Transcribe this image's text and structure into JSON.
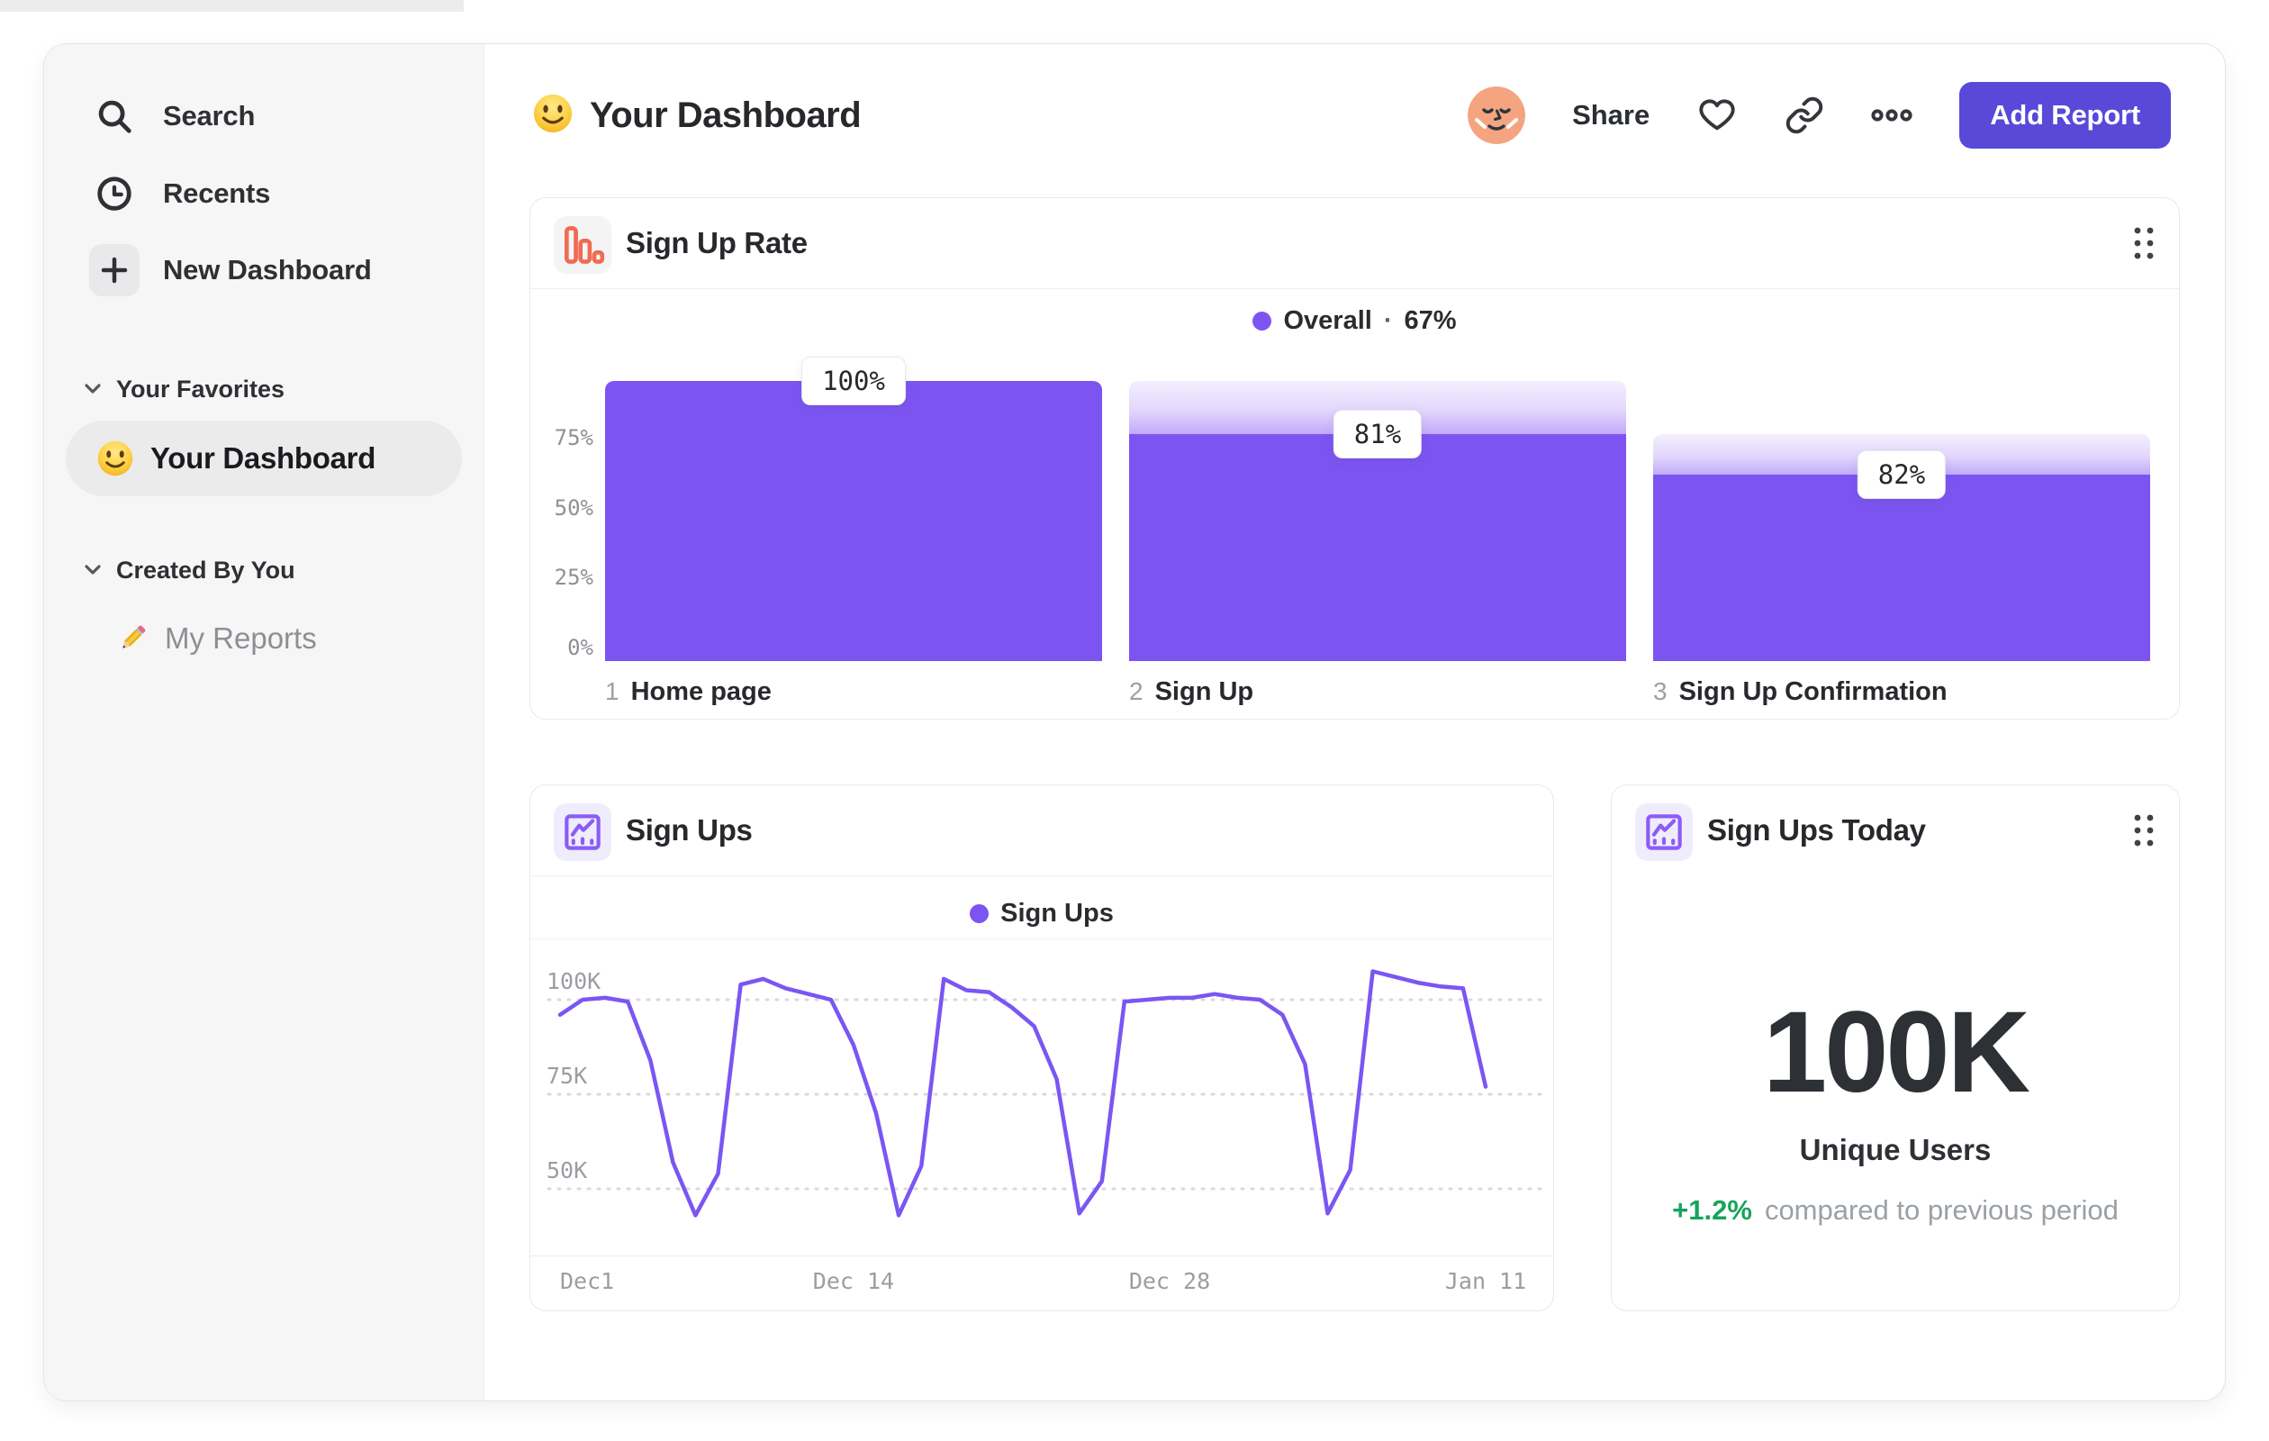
{
  "header": {
    "title": "Your Dashboard",
    "share_label": "Share",
    "add_report_label": "Add Report"
  },
  "sidebar": {
    "items": [
      {
        "label": "Search",
        "icon": "search-icon"
      },
      {
        "label": "Recents",
        "icon": "clock-icon"
      },
      {
        "label": "New Dashboard",
        "icon": "plus-icon"
      }
    ],
    "sections": [
      {
        "title": "Your Favorites",
        "items": [
          {
            "label": "Your Dashboard",
            "icon": "smiley-emoji",
            "selected": true
          }
        ]
      },
      {
        "title": "Created By You",
        "items": [
          {
            "label": "My Reports",
            "icon": "pencil-emoji",
            "selected": false
          }
        ]
      }
    ]
  },
  "colors": {
    "purple": "#7C55F1",
    "indigo_button": "#5849D8",
    "orange_icon": "#EF6B51",
    "green_delta": "#17A45B"
  },
  "chart_data": [
    {
      "type": "funnel",
      "title": "Sign Up Rate",
      "legend": {
        "series": "Overall",
        "separator": "·",
        "overall_value": "67%"
      },
      "steps": [
        {
          "index": "1",
          "label": "Home page",
          "conversion_from_previous_pct": 100,
          "display": "100%"
        },
        {
          "index": "2",
          "label": "Sign Up",
          "conversion_from_previous_pct": 81,
          "display": "81%"
        },
        {
          "index": "3",
          "label": "Sign Up Confirmation",
          "conversion_from_previous_pct": 82,
          "display": "82%"
        }
      ],
      "y_ticks": [
        {
          "label": "75%",
          "value": 75
        },
        {
          "label": "50%",
          "value": 50
        },
        {
          "label": "25%",
          "value": 25
        },
        {
          "label": "0%",
          "value": 0
        }
      ],
      "ylim": [
        0,
        100
      ],
      "bar_color": "#7C55F1"
    },
    {
      "type": "line",
      "title": "Sign Ups",
      "series": [
        {
          "name": "Sign Ups",
          "color": "#7A56F2",
          "values_thousands": [
            96,
            100,
            100.5,
            99.5,
            84,
            57,
            43,
            54,
            104,
            105.5,
            103,
            101.5,
            100,
            88,
            70,
            43,
            56,
            105.5,
            102.5,
            102,
            98,
            93,
            79,
            43.5,
            52,
            99.5,
            100,
            100.5,
            100.5,
            101.5,
            100.5,
            100,
            96,
            83,
            43.5,
            55,
            107.5,
            106,
            104.5,
            103.5,
            103,
            77
          ]
        }
      ],
      "x_ticks": [
        {
          "label": "Dec1",
          "day": 0
        },
        {
          "label": "Dec 14",
          "day": 13
        },
        {
          "label": "Dec 28",
          "day": 27
        },
        {
          "label": "Jan 11",
          "day": 41
        }
      ],
      "y_ticks": [
        {
          "label": "100K",
          "value": 100
        },
        {
          "label": "75K",
          "value": 75
        },
        {
          "label": "50K",
          "value": 50
        }
      ],
      "days_total": 42,
      "grid": "dashed-horizontal",
      "legend_position": "top-center"
    },
    {
      "type": "metric",
      "title": "Sign Ups Today",
      "value": "100K",
      "label": "Unique Users",
      "delta": "+1.2%",
      "delta_caption": "compared to previous period"
    }
  ]
}
